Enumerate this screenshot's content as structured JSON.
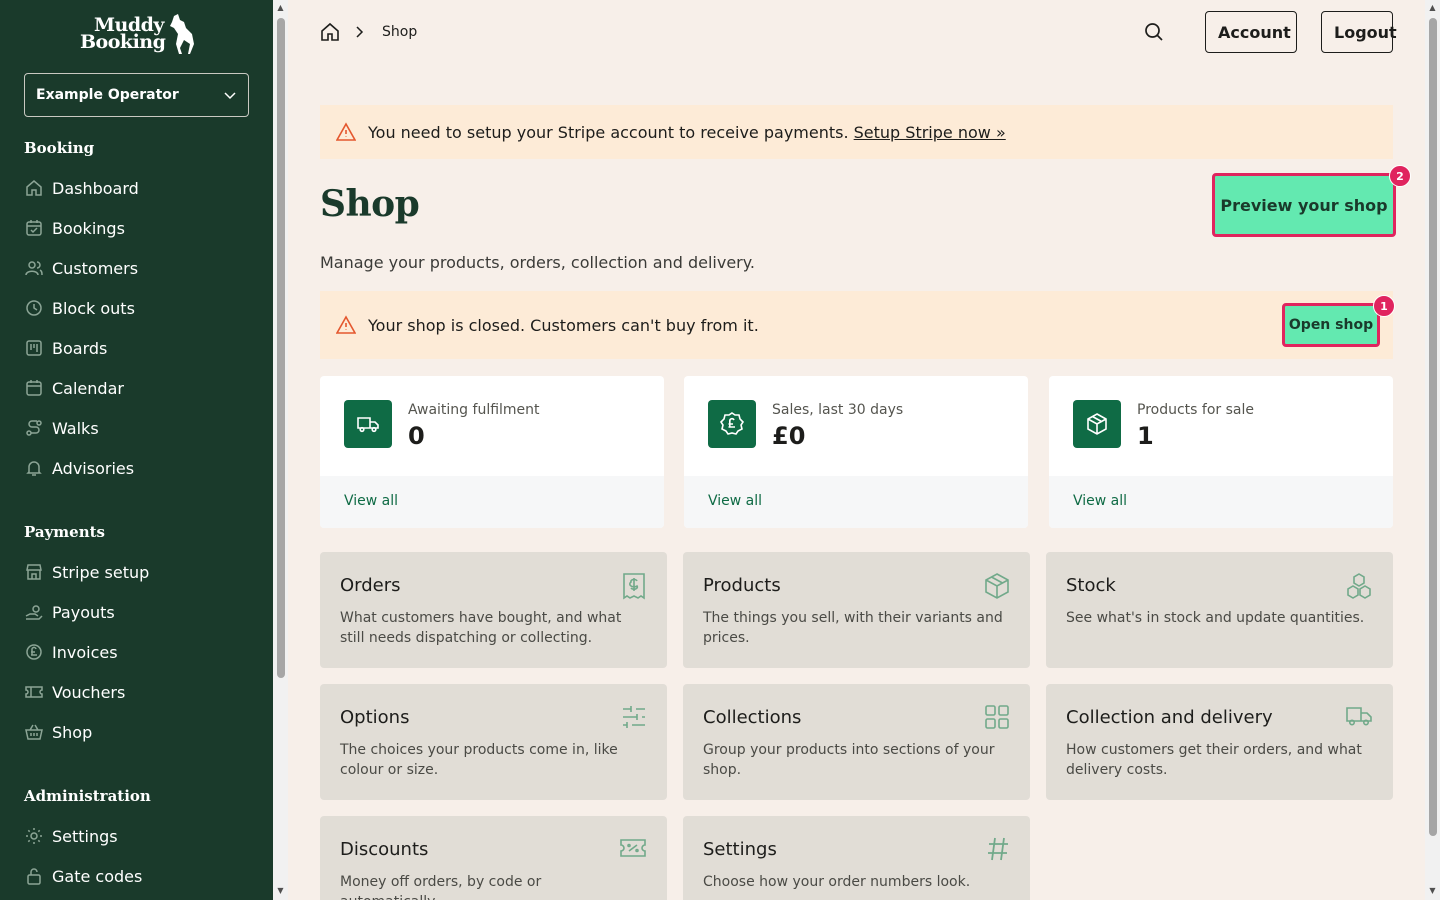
{
  "app": {
    "logo_line1": "Muddy",
    "logo_line2": "Booking"
  },
  "operator": {
    "selected": "Example Operator"
  },
  "sidebar": {
    "sections": [
      {
        "title": "Booking"
      },
      {
        "title": "Payments"
      },
      {
        "title": "Administration"
      }
    ],
    "items": [
      {
        "label": "Dashboard",
        "icon": "home-icon"
      },
      {
        "label": "Bookings",
        "icon": "calendar-check-icon"
      },
      {
        "label": "Customers",
        "icon": "users-icon"
      },
      {
        "label": "Block outs",
        "icon": "clock-icon"
      },
      {
        "label": "Boards",
        "icon": "board-icon"
      },
      {
        "label": "Calendar",
        "icon": "calendar-icon"
      },
      {
        "label": "Walks",
        "icon": "route-icon"
      },
      {
        "label": "Advisories",
        "icon": "bell-icon"
      },
      {
        "label": "Stripe setup",
        "icon": "store-icon"
      },
      {
        "label": "Payouts",
        "icon": "payouts-icon"
      },
      {
        "label": "Invoices",
        "icon": "pound-circle-icon"
      },
      {
        "label": "Vouchers",
        "icon": "ticket-icon"
      },
      {
        "label": "Shop",
        "icon": "basket-icon"
      },
      {
        "label": "Settings",
        "icon": "gear-icon"
      },
      {
        "label": "Gate codes",
        "icon": "lock-icon"
      }
    ]
  },
  "breadcrumb": {
    "current": "Shop"
  },
  "header": {
    "account": "Account",
    "logout": "Logout"
  },
  "stripe_alert": {
    "text": "You need to setup your Stripe account to receive payments.",
    "link": "Setup Stripe now »"
  },
  "page": {
    "title": "Shop",
    "subtitle": "Manage your products, orders, collection and delivery.",
    "preview_button": "Preview your shop",
    "preview_badge": "2"
  },
  "shop_alert": {
    "text": "Your shop is closed. Customers can't buy from it.",
    "button": "Open shop",
    "badge": "1"
  },
  "stats": [
    {
      "label": "Awaiting fulfilment",
      "value": "0",
      "link": "View all",
      "icon": "truck-icon"
    },
    {
      "label": "Sales, last 30 days",
      "value": "£0",
      "link": "View all",
      "icon": "pound-badge-icon"
    },
    {
      "label": "Products for sale",
      "value": "1",
      "link": "View all",
      "icon": "package-icon"
    }
  ],
  "tiles": [
    {
      "title": "Orders",
      "desc": "What customers have bought, and what still needs dispatching or collecting.",
      "icon": "receipt-icon"
    },
    {
      "title": "Products",
      "desc": "The things you sell, with their variants and prices.",
      "icon": "box-icon"
    },
    {
      "title": "Stock",
      "desc": "See what's in stock and update quantities.",
      "icon": "boxes-icon"
    },
    {
      "title": "Options",
      "desc": "The choices your products come in, like colour or size.",
      "icon": "sliders-icon"
    },
    {
      "title": "Collections",
      "desc": "Group your products into sections of your shop.",
      "icon": "grid-icon"
    },
    {
      "title": "Collection and delivery",
      "desc": "How customers get their orders, and what delivery costs.",
      "icon": "truck-icon"
    },
    {
      "title": "Discounts",
      "desc": "Money off orders, by code or automatically.",
      "icon": "discount-ticket-icon"
    },
    {
      "title": "Settings",
      "desc": "Choose how your order numbers look.",
      "icon": "hash-icon"
    }
  ]
}
